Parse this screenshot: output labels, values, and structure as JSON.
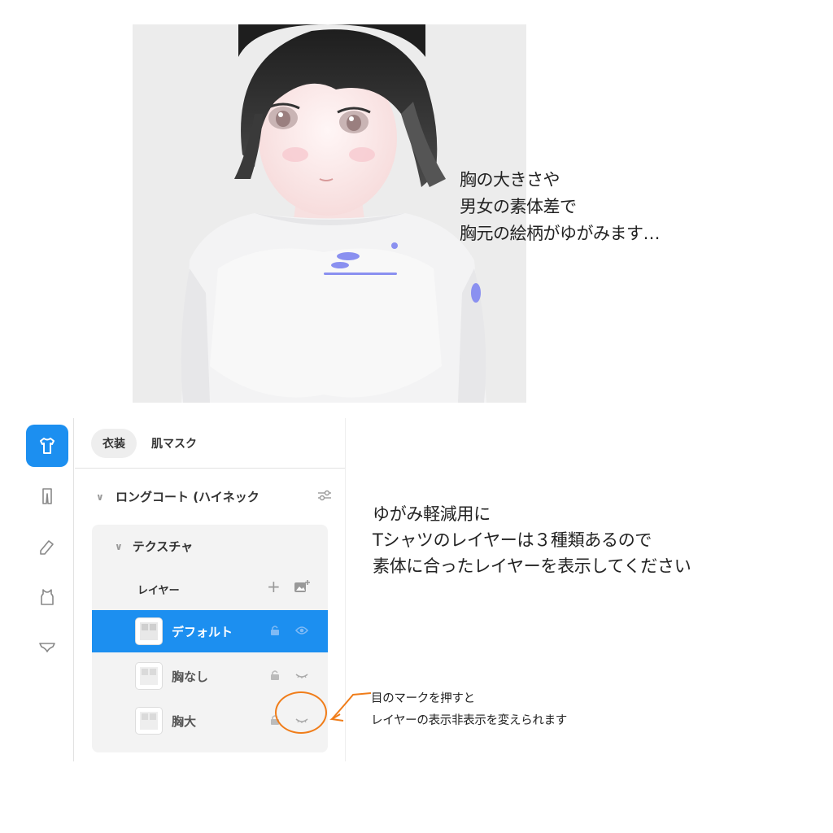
{
  "notes": {
    "top": "胸の大きさや\n男女の素体差で\n胸元の絵柄がゆがみます…",
    "middle": "ゆがみ軽減用に\nTシャツのレイヤーは３種類あるので\n素体に合ったレイヤーを表示してください",
    "bottom": "目のマークを押すと\nレイヤーの表示非表示を変えられます"
  },
  "sidebar": {
    "categories": [
      {
        "icon": "tshirt-icon",
        "active": true
      },
      {
        "icon": "pants-icon",
        "active": false
      },
      {
        "icon": "shoe-icon",
        "active": false
      },
      {
        "icon": "tank-top-icon",
        "active": false
      },
      {
        "icon": "underwear-icon",
        "active": false
      }
    ]
  },
  "tabs": [
    {
      "label": "衣装",
      "active": true
    },
    {
      "label": "肌マスク",
      "active": false
    }
  ],
  "item": {
    "title": "ロングコート (ハイネック"
  },
  "texture": {
    "title": "テクスチャ",
    "layers_label": "レイヤー",
    "layers": [
      {
        "name": "デフォルト",
        "selected": true,
        "visible": true
      },
      {
        "name": "胸なし",
        "selected": false,
        "visible": false
      },
      {
        "name": "胸大",
        "selected": false,
        "visible": false
      }
    ]
  },
  "colors": {
    "accent": "#1c8ff0",
    "annotation": "#f07d1a"
  }
}
